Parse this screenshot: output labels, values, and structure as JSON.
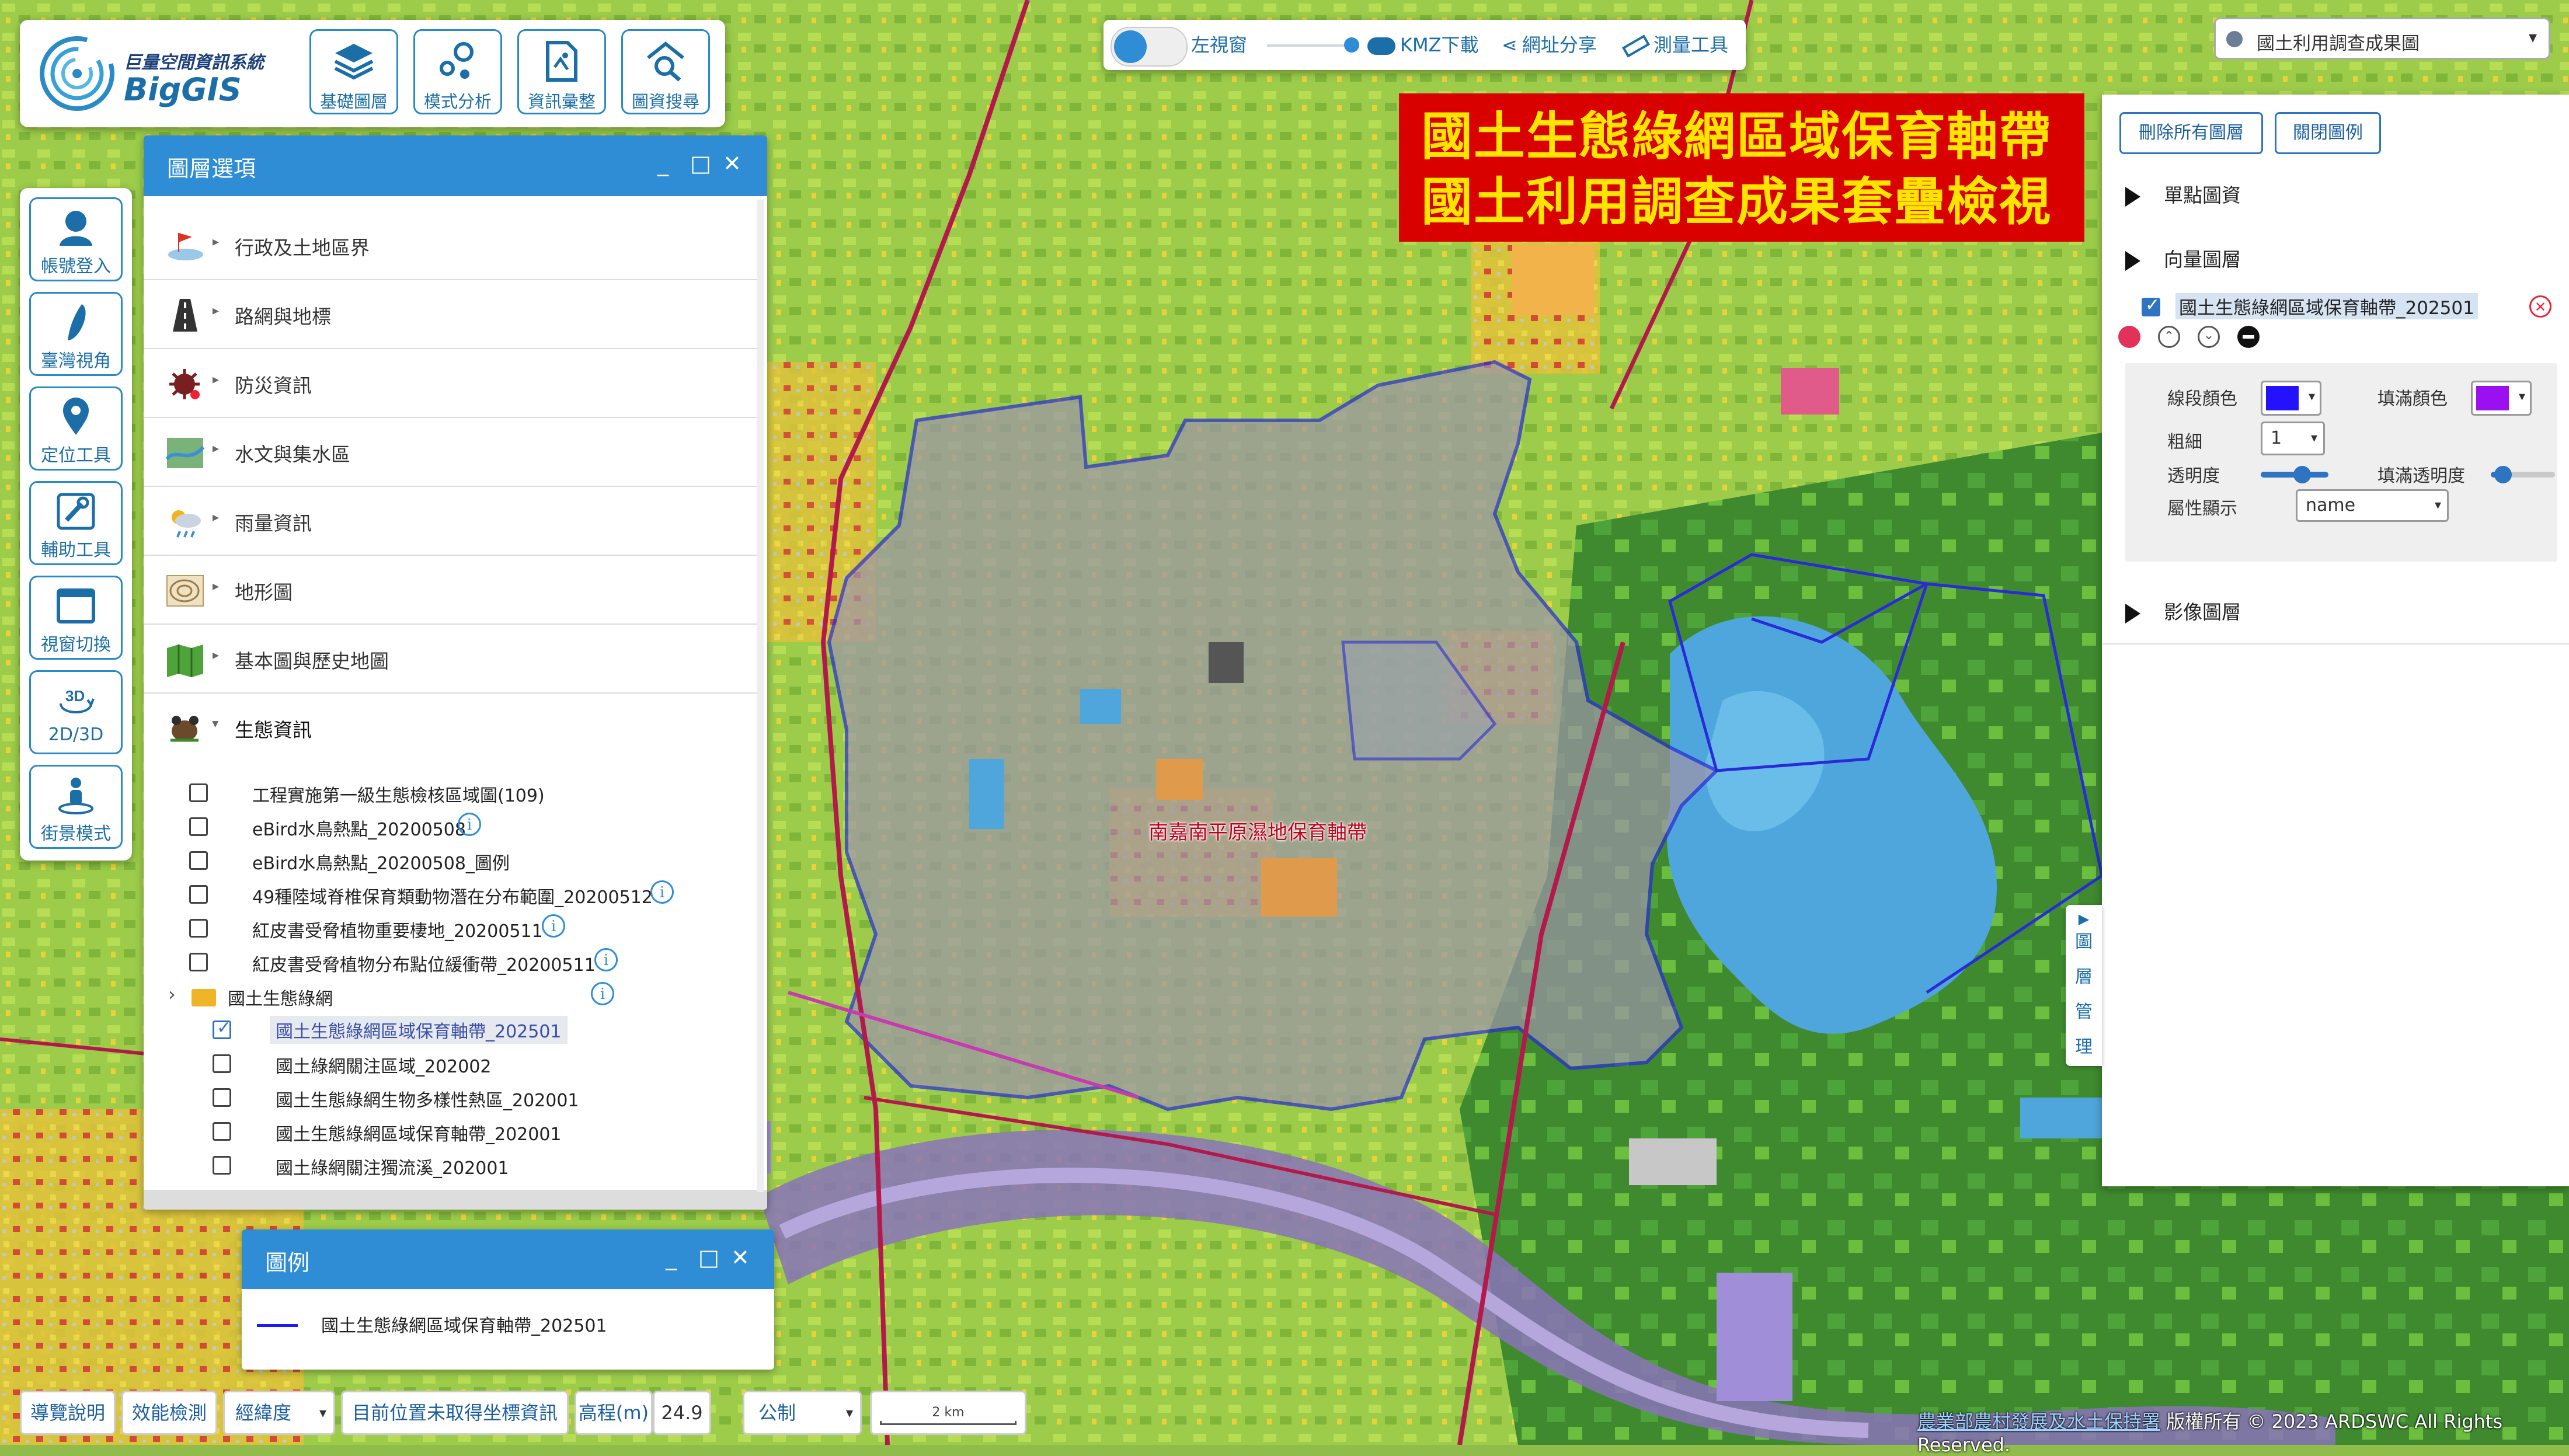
{
  "app": {
    "name_cn": "巨量空間資訊系統",
    "name_en": "BigGIS"
  },
  "toolbar": [
    {
      "label": "基礎圖層",
      "icon": "layers-icon"
    },
    {
      "label": "模式分析",
      "icon": "analysis-icon"
    },
    {
      "label": "資訊彙整",
      "icon": "document-map-icon"
    },
    {
      "label": "圖資搜尋",
      "icon": "search-map-icon"
    }
  ],
  "center_bar": {
    "left_window_label": "左視窗",
    "kmz_label": "KMZ下載",
    "share_label": "網址分享",
    "measure_label": "測量工具"
  },
  "scene_select": {
    "value": "國土利用調查成果圖"
  },
  "left_tools": [
    {
      "label": "帳號登入",
      "icon": "user-icon"
    },
    {
      "label": "臺灣視角",
      "icon": "taiwan-icon"
    },
    {
      "label": "定位工具",
      "icon": "location-pin-icon"
    },
    {
      "label": "輔助工具",
      "icon": "tools-icon"
    },
    {
      "label": "視窗切換",
      "icon": "window-icon"
    },
    {
      "label": "2D/3D",
      "icon": "3d-icon",
      "icon_text": "3D"
    },
    {
      "label": "街景模式",
      "icon": "street-view-icon"
    }
  ],
  "layer_window": {
    "title": "圖層選項",
    "categories": [
      {
        "label": "行政及土地區界"
      },
      {
        "label": "路網與地標"
      },
      {
        "label": "防災資訊"
      },
      {
        "label": "水文與集水區"
      },
      {
        "label": "雨量資訊"
      },
      {
        "label": "地形圖"
      },
      {
        "label": "基本圖與歷史地圖"
      },
      {
        "label": "生態資訊"
      }
    ],
    "eco_items": [
      {
        "label": "工程實施第一級生態檢核區域圖(109)",
        "checked": false,
        "info": false
      },
      {
        "label": "eBird水鳥熱點_20200508",
        "checked": false,
        "info": true
      },
      {
        "label": "eBird水鳥熱點_20200508_圖例",
        "checked": false,
        "info": false
      },
      {
        "label": "49種陸域脊椎保育類動物潛在分布範圍_20200512",
        "checked": false,
        "info": true
      },
      {
        "label": "紅皮書受脅植物重要棲地_20200511",
        "checked": false,
        "info": true
      },
      {
        "label": "紅皮書受脅植物分布點位緩衝帶_20200511",
        "checked": false,
        "info": true
      }
    ],
    "folder": {
      "label": "國土生態綠網"
    },
    "folder_items": [
      {
        "label": "國土生態綠網區域保育軸帶_202501",
        "checked": true
      },
      {
        "label": "國土綠網關注區域_202002",
        "checked": false
      },
      {
        "label": "國土生態綠網生物多樣性熱區_202001",
        "checked": false
      },
      {
        "label": "國土生態綠網區域保育軸帶_202001",
        "checked": false
      },
      {
        "label": "國土綠網關注獨流溪_202001",
        "checked": false
      }
    ]
  },
  "legend_window": {
    "title": "圖例",
    "item": "國土生態綠網區域保育軸帶_202501",
    "line_color": "#1a1aff"
  },
  "title_overlay": {
    "line1": "國土生態綠網區域保育軸帶",
    "line2": "國土利用調查成果套疊檢視"
  },
  "right_panel": {
    "remove_all": "刪除所有圖層",
    "close_legend": "關閉圖例",
    "single_point": "單點圖資",
    "vector_layers": "向量圖層",
    "active_layer": "國土生態綠網區域保育軸帶_202501",
    "line_color_label": "線段顏色",
    "fill_color_label": "填滿顏色",
    "line_color": "#2412ff",
    "fill_color": "#9a10f0",
    "width_label": "粗細",
    "width_value": "1",
    "opacity_label": "透明度",
    "fill_opacity_label": "填滿透明度",
    "opacity": 0.55,
    "fill_opacity": 0.15,
    "attr_label": "屬性顯示",
    "attr_value": "name",
    "image_layers": "影像圖層"
  },
  "layer_mgmt_tab": {
    "chars": [
      "圖",
      "層",
      "管",
      "理"
    ]
  },
  "map_label": "南嘉南平原濕地保育軸帶",
  "bottom_bar": {
    "guide": "導覽說明",
    "perf": "效能檢測",
    "coord_sys": "經緯度",
    "position": "目前位置未取得坐標資訊",
    "elev_label": "高程(m)",
    "elev_value": "24.9",
    "unit": "公制",
    "scale": "2 km"
  },
  "copyright": {
    "org": "農業部農村發展及水土保持署",
    "text": "版權所有 © 2023 ARDSWC All Rights Reserved."
  }
}
